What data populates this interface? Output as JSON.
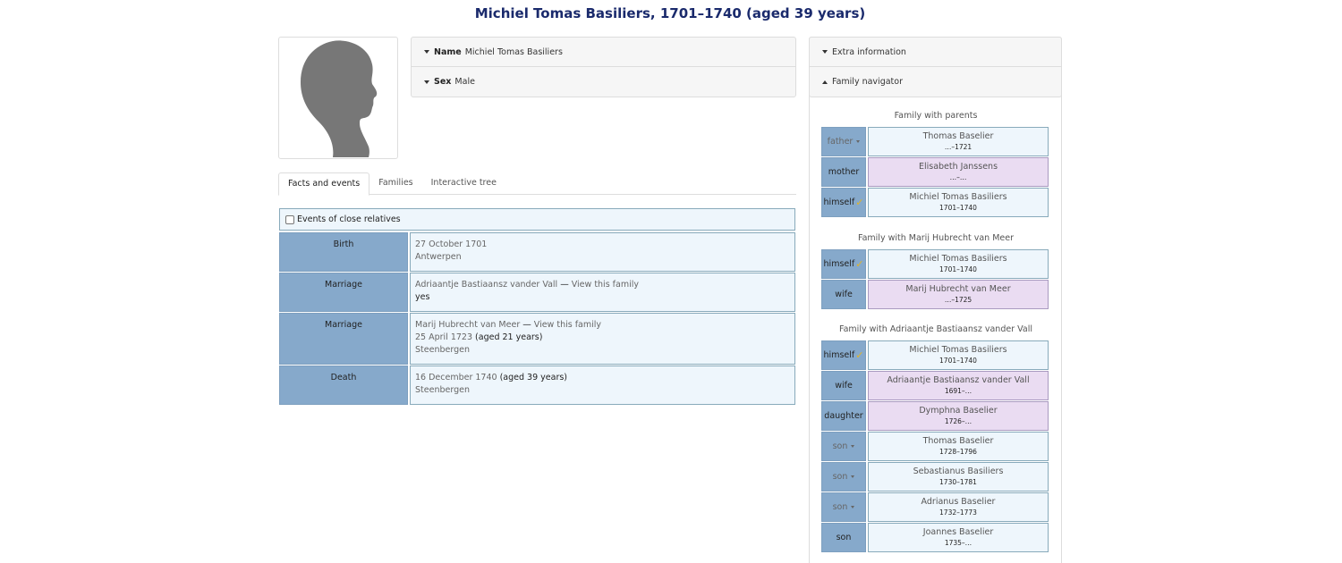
{
  "page": {
    "title": "Michiel Tomas Basiliers, 1701–1740 (aged 39 years)"
  },
  "summary": {
    "name_label": "Name",
    "name_value": "Michiel Tomas Basiliers",
    "sex_label": "Sex",
    "sex_value": "Male"
  },
  "side": {
    "extra_label": "Extra information",
    "navigator_label": "Family navigator"
  },
  "tabs": [
    "Facts and events",
    "Families",
    "Interactive tree"
  ],
  "close_relatives_label": "Events of close relatives",
  "events": [
    {
      "label": "Birth",
      "lines": [
        "27 October 1701",
        "Antwerpen"
      ]
    },
    {
      "label": "Marriage",
      "line1_a": "Adriaantje Bastiaansz vander Vall",
      "line1_sep": " — ",
      "line1_b": "View this family",
      "line2": "yes"
    },
    {
      "label": "Marriage",
      "line1_a": "Marij Hubrecht van Meer",
      "line1_sep": " — ",
      "line1_b": "View this family",
      "line2_a": "25 April 1723",
      "line2_b": " (aged 21 years)",
      "line3": "Steenbergen"
    },
    {
      "label": "Death",
      "line1_a": "16 December 1740",
      "line1_b": " (aged 39 years)",
      "line2": "Steenbergen"
    }
  ],
  "families": [
    {
      "title": "Family with parents",
      "members": [
        {
          "role": "father",
          "name": "Thomas Baselier",
          "dates": "…–1721",
          "sex": "male",
          "dropdown": true
        },
        {
          "role": "mother",
          "name": "Elisabeth Janssens",
          "dates": "…–…",
          "sex": "female"
        },
        {
          "role": "himself",
          "name": "Michiel Tomas Basiliers",
          "dates": "1701–1740",
          "sex": "male",
          "check": true
        }
      ]
    },
    {
      "title": "Family with Marij Hubrecht van Meer",
      "members": [
        {
          "role": "himself",
          "name": "Michiel Tomas Basiliers",
          "dates": "1701–1740",
          "sex": "male",
          "check": true
        },
        {
          "role": "wife",
          "name": "Marij Hubrecht van Meer",
          "dates": "…–1725",
          "sex": "female"
        }
      ]
    },
    {
      "title": "Family with Adriaantje Bastiaansz vander Vall",
      "members": [
        {
          "role": "himself",
          "name": "Michiel Tomas Basiliers",
          "dates": "1701–1740",
          "sex": "male",
          "check": true
        },
        {
          "role": "wife",
          "name": "Adriaantje Bastiaansz vander Vall",
          "dates": "1691–…",
          "sex": "female"
        },
        {
          "role": "daughter",
          "name": "Dymphna Baselier",
          "dates": "1726–…",
          "sex": "female"
        },
        {
          "role": "son",
          "name": "Thomas Baselier",
          "dates": "1728–1796",
          "sex": "male",
          "dropdown": true
        },
        {
          "role": "son",
          "name": "Sebastianus Basiliers",
          "dates": "1730–1781",
          "sex": "male",
          "dropdown": true
        },
        {
          "role": "son",
          "name": "Adrianus Baselier",
          "dates": "1732–1773",
          "sex": "male",
          "dropdown": true
        },
        {
          "role": "son",
          "name": "Joannes Baselier",
          "dates": "1735–…",
          "sex": "male"
        }
      ]
    }
  ]
}
